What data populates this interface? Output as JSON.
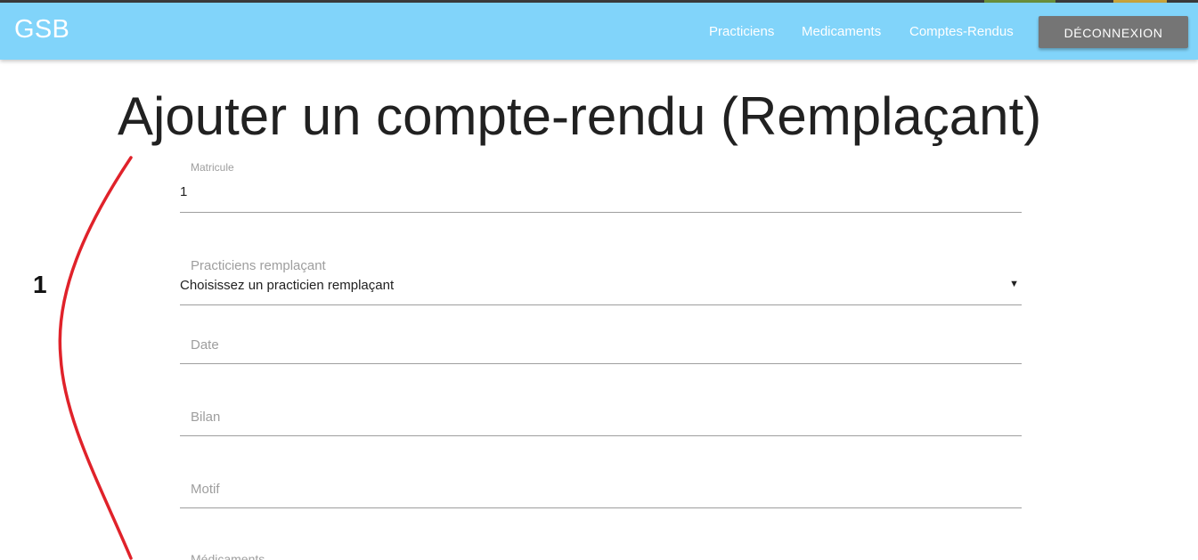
{
  "navbar": {
    "brand": "GSB",
    "links": [
      "Practiciens",
      "Medicaments",
      "Comptes-Rendus"
    ],
    "logout_label": "DÉCONNEXION",
    "background": "#81d4fa"
  },
  "page": {
    "title": "Ajouter un compte-rendu (Remplaçant)"
  },
  "form": {
    "matricule": {
      "label": "Matricule",
      "value": "1"
    },
    "practicien": {
      "label": "Practiciens remplaçant",
      "selected": "Choisissez un practicien remplaçant"
    },
    "date": {
      "label": "Date"
    },
    "bilan": {
      "label": "Bilan"
    },
    "motif": {
      "label": "Motif"
    },
    "medicaments": {
      "label": "Médicaments"
    }
  },
  "annotation": {
    "number": "1",
    "color": "#e0222a"
  }
}
